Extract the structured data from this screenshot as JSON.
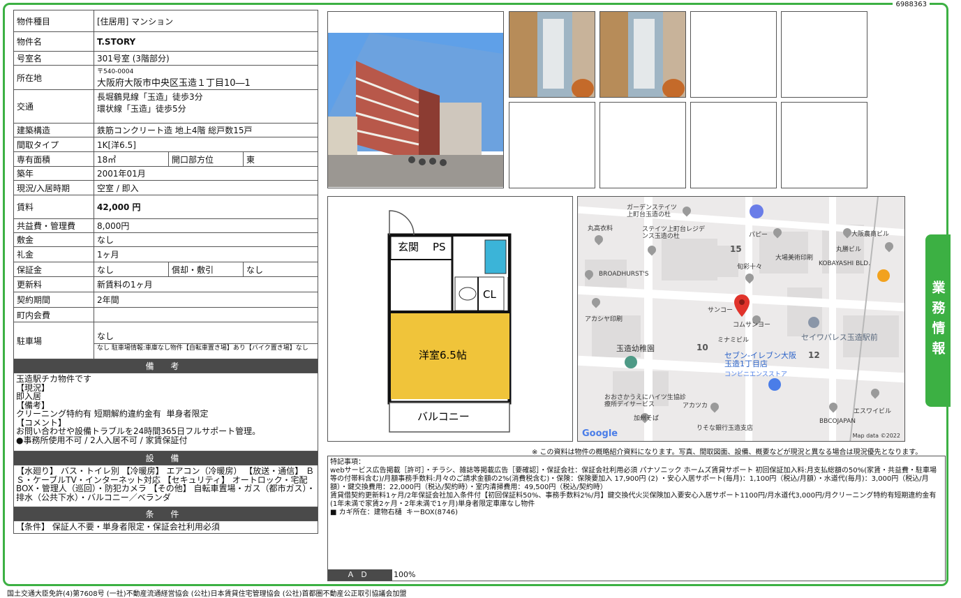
{
  "id_number": "6988363",
  "spec": {
    "type_label": "物件種目",
    "type_value": "[住居用] マンション",
    "name_label": "物件名",
    "name_value": "T.STORY",
    "room_label": "号室名",
    "room_value": "301号室 (3階部分)",
    "address_label": "所在地",
    "postal": "〒540-0004",
    "address_value": "大阪府大阪市中央区玉造１丁目10―1",
    "transit_label": "交通",
    "transit_1": "長堀鶴見線「玉造」徒歩3分",
    "transit_2": "環状線「玉造」徒歩5分",
    "structure_label": "建築構造",
    "structure_value": "鉄筋コンクリート造 地上4階 総戸数15戸",
    "layout_label": "間取タイプ",
    "layout_value": "1K[洋6.5]",
    "area_label": "専有面積",
    "area_value": "18㎡",
    "facing_label": "開口部方位",
    "facing_value": "東",
    "built_label": "築年",
    "built_value": "2001年01月",
    "status_label": "現況/入居時期",
    "status_value": "空室 / 即入",
    "rent_label": "賃料",
    "rent_value": "42,000 円",
    "fee_label": "共益費・管理費",
    "fee_value": "8,000円",
    "deposit_label": "敷金",
    "deposit_value": "なし",
    "key_label": "礼金",
    "key_value": "1ヶ月",
    "guarantee_label": "保証金",
    "guarantee_value": "なし",
    "amort_label": "償却・敷引",
    "amort_value": "なし",
    "renewal_label": "更新料",
    "renewal_value": "新賃料の1ヶ月",
    "contract_label": "契約期間",
    "contract_value": "2年間",
    "town_label": "町内会費",
    "town_value": "",
    "parking_label": "駐車場",
    "parking_value": "なし",
    "parking_detail": "なし 駐車場情報:車庫なし物件【自転車置き場】あり【バイク置き場】なし"
  },
  "notes": {
    "header": "備 考",
    "text": "玉造駅チカ物件です\n【現況】\n即入居\n【備考】\nクリーニング特約有 短期解約違約金有  単身者限定\n【コメント】\nお問い合わせや設備トラブルを24時間365日フルサポート管理。\n●事務所使用不可 / 2人入居不可 / 家賃保証付"
  },
  "equipment": {
    "header": "設 備",
    "text": "【水廻り】 バス・トイレ別 【冷暖房】 エアコン（冷暖房） 【放送・通信】 ＢＳ・ケーブルTV・インターネット対応 【セキュリティ】 オートロック・宅配BOX・管理人（巡回）・防犯カメラ 【その他】 自転車置場・ガス（都市ガス）・排水（公共下水）・バルコニー／ベランダ"
  },
  "conditions": {
    "header": "条 件",
    "text": "【条件】 保証人不要・単身者限定・保証会社利用必須"
  },
  "floorplan": {
    "genkan": "玄関",
    "ps": "PS",
    "cl": "CL",
    "room": "洋室6.5帖",
    "balcony": "バルコニー"
  },
  "map": {
    "labels": [
      "ガーデンステイツ上町台玉造の杜",
      "丸高衣料",
      "ステイツ上町台レジデンス玉造の杜",
      "パピー",
      "大阪農商ビル",
      "15",
      "大場美術印刷",
      "丸勝ビル",
      "旬彩十々",
      "KOBAYASHI BLD.",
      "BROADHURST'S",
      "サンコー",
      "コムサンヨー",
      "アカシヤ印刷",
      "ミナミビル",
      "セイワパレス玉造駅前",
      "玉造幼稚園",
      "10",
      "12",
      "セブン-イレブン大阪玉造1丁目店",
      "コンビニエンスストア",
      "おおさかうえにハイツ生協診療所デイサービス",
      "アカツカ",
      "加州そば",
      "りそな銀行玉造支店",
      "エスワイビル",
      "BBCOJAPAN"
    ],
    "credit": "Map data ©2022",
    "logo": "Google"
  },
  "disclaimer": "※ この資料は物件の概略紹介資料になります。写真、間取図面、設備、概要などが現況と異なる場合は現況優先となります。",
  "remarks": {
    "text": "特記事項：\nwebサービス広告掲載［許可］・チラシ、雑誌等掲載広告［要確認］・保証会社：保証会社利用必須 パナソニック ホームズ賃貸サポート 初回保証加入料:月支払総額の50%(家賃・共益費・駐車場等の付帯料含む)/月額事務手数料:月々のご請求金額の2%(消費税含む)・保険：保険要加入 17,900円 (2) ・安心入居サポート(毎月)：1,100円（税込/月額）・水道代(毎月)：3,000円（税込/月額）・鍵交換費用：22,000円（税込/契約時）・室内清掃費用：49,500円（税込/契約時）\n賃貸借契約更新料1ヶ月/2年保証会社加入条件付【初回保証料50%、事務手数料2%/月】鍵交換代火災保険加入要安心入居サポート1100円/月水道代3,000円/月クリーニング特約有短期違約金有(1年未満で家賃2ヶ月・2年未満で1ヶ月)単身者限定車庫なし物件\n■ カギ所在：建物右樋  キーBOX(8746)",
    "ad_label": "ＡＤ",
    "ad_value": "100%"
  },
  "side_tab": "業務情報",
  "footer": "国土交通大臣免許(4)第7608号 (一社)不動産流通経営協会 (公社)日本賃貸住宅管理協会 (公社)首都圏不動産公正取引協議会加盟"
}
